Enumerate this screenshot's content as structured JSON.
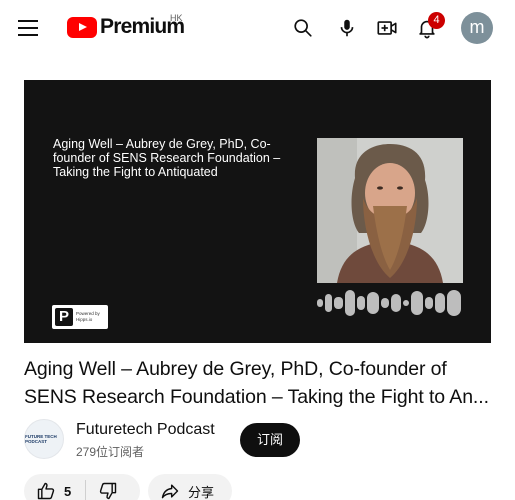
{
  "header": {
    "logo_text": "Premium",
    "region": "HK",
    "notification_count": "4",
    "avatar_letter": "m"
  },
  "thumbnail": {
    "overlay_title": "Aging Well – Aubrey de Grey, PhD, Co-founder of SENS Research Foundation – Taking the Fight to Antiquated",
    "podcast_logo_letter": "P",
    "podcast_logo_caption": "Powered by Hipps.io"
  },
  "video": {
    "title": "Aging Well – Aubrey de Grey, PhD, Co-founder of SENS Research Foundation – Taking the Fight to An..."
  },
  "channel": {
    "avatar_text": "FUTURE TECH PODCAST",
    "name": "Futuretech Podcast",
    "subscribers": "279位订阅者",
    "subscribe_label": "订阅"
  },
  "actions": {
    "like_count": "5",
    "share_label": "分享"
  },
  "colors": {
    "brand_red": "#ff0000",
    "badge_red": "#cc0000",
    "avatar_bg": "#7d909a",
    "thumb_bg": "#131313"
  },
  "icons": [
    "menu-icon",
    "youtube-logo-icon",
    "search-icon",
    "mic-icon",
    "create-icon",
    "bell-icon",
    "thumbs-up-icon",
    "thumbs-down-icon",
    "share-icon"
  ]
}
